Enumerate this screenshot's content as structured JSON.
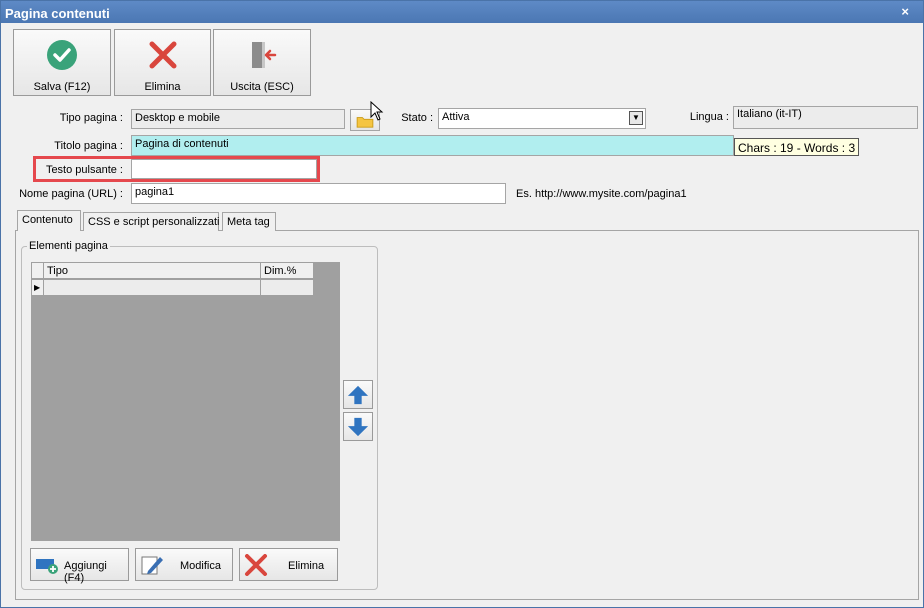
{
  "window": {
    "title": "Pagina contenuti",
    "close_glyph": "×"
  },
  "toolbar": {
    "save_label": "Salva (F12)",
    "delete_label": "Elimina",
    "exit_label": "Uscita (ESC)"
  },
  "form": {
    "tipo_pagina": {
      "label": "Tipo pagina :",
      "value": "Desktop e mobile"
    },
    "stato": {
      "label": "Stato :",
      "value": "Attiva"
    },
    "lingua": {
      "label": "Lingua :",
      "value": "Italiano (it-IT)"
    },
    "titolo_pagina": {
      "label": "Titolo pagina :",
      "value": "Pagina di contenuti"
    },
    "titolo_counter": "Chars : 19 - Words : 3",
    "testo_pulsante": {
      "label": "Testo pulsante :",
      "value": ""
    },
    "nome_pagina": {
      "label": "Nome pagina (URL) :",
      "value": "pagina1"
    },
    "url_example": "Es. http://www.mysite.com/pagina1"
  },
  "tabs": [
    {
      "label": "Contenuto",
      "active": true
    },
    {
      "label": "CSS e script personalizzati",
      "active": false
    },
    {
      "label": "Meta tag",
      "active": false
    }
  ],
  "elementi_pagina": {
    "legend": "Elementi pagina",
    "columns": [
      "Tipo",
      "Dim.%"
    ],
    "rows": [],
    "row_indicator": "▶"
  },
  "bottom_buttons": {
    "add_label": "Aggiungi (F4)",
    "edit_label": "Modifica",
    "delete_label": "Elimina"
  },
  "colors": {
    "titlebar": "#4b77b3",
    "title_field": "#b1eeef",
    "highlight": "#e5484d",
    "save_icon": "#3aa37a",
    "delete_icon": "#d9463d",
    "arrow_icon": "#2f74c0"
  },
  "icons": {
    "save": "checkmark-circle-icon",
    "delete": "x-cross-icon",
    "exit": "door-exit-icon",
    "folder": "folder-icon",
    "up": "arrow-up-icon",
    "down": "arrow-down-icon",
    "add": "add-element-icon",
    "edit": "edit-pencil-icon"
  }
}
